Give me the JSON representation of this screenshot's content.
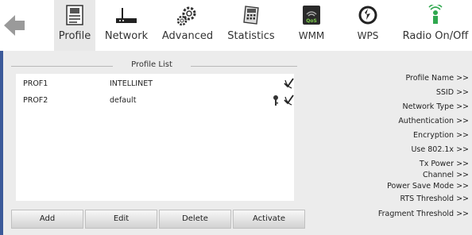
{
  "toolbar": {
    "items": [
      {
        "label": "Profile",
        "icon": "profile-icon"
      },
      {
        "label": "Network",
        "icon": "network-icon"
      },
      {
        "label": "Advanced",
        "icon": "advanced-gear-icon"
      },
      {
        "label": "Statistics",
        "icon": "statistics-icon"
      },
      {
        "label": "WMM",
        "icon": "wmm-qos-icon"
      },
      {
        "label": "WPS",
        "icon": "wps-icon"
      },
      {
        "label": "Radio On/Off",
        "icon": "radio-icon"
      }
    ],
    "active": "Profile"
  },
  "profile_list": {
    "title": "Profile List",
    "rows": [
      {
        "name": "PROF1",
        "ssid": "INTELLINET",
        "active": true,
        "secured": false
      },
      {
        "name": "PROF2",
        "ssid": "default",
        "active": true,
        "secured": true
      }
    ]
  },
  "buttons": {
    "add": "Add",
    "edit": "Edit",
    "delete": "Delete",
    "activate": "Activate"
  },
  "details": {
    "labels": [
      "Profile Name >>",
      "SSID >>",
      "Network Type >>",
      "Authentication >>",
      "Encryption >>",
      "Use 802.1x >>",
      "Tx Power >>",
      "Channel >>",
      "Power Save Mode >>",
      "RTS Threshold >>",
      "Fragment Threshold >>"
    ]
  },
  "colors": {
    "left_bar": "#3c5a9a",
    "panel_bg": "#ececec",
    "back_arrow": "#9a9a9a"
  }
}
